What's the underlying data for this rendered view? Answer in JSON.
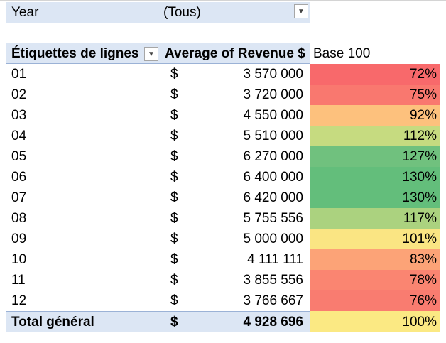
{
  "filter": {
    "label": "Year",
    "value": "(Tous)"
  },
  "header": {
    "row_labels": "Étiquettes de lignes",
    "revenue": "Average of Revenue $",
    "base": "Base 100"
  },
  "rows": [
    {
      "label": "01",
      "currency": "$",
      "value": "3 570 000",
      "base": "72%",
      "color": "#f8696b"
    },
    {
      "label": "02",
      "currency": "$",
      "value": "3 720 000",
      "base": "75%",
      "color": "#f9786f"
    },
    {
      "label": "03",
      "currency": "$",
      "value": "4 550 000",
      "base": "92%",
      "color": "#fdc17d"
    },
    {
      "label": "04",
      "currency": "$",
      "value": "5 510 000",
      "base": "112%",
      "color": "#c6db80"
    },
    {
      "label": "05",
      "currency": "$",
      "value": "6 270 000",
      "base": "127%",
      "color": "#70c17e"
    },
    {
      "label": "06",
      "currency": "$",
      "value": "6 400 000",
      "base": "130%",
      "color": "#63be7b"
    },
    {
      "label": "07",
      "currency": "$",
      "value": "6 420 000",
      "base": "130%",
      "color": "#63be7b"
    },
    {
      "label": "08",
      "currency": "$",
      "value": "5 755 556",
      "base": "117%",
      "color": "#abd27f"
    },
    {
      "label": "09",
      "currency": "$",
      "value": "5 000 000",
      "base": "101%",
      "color": "#fae583"
    },
    {
      "label": "10",
      "currency": "$",
      "value": "4 111 111",
      "base": "83%",
      "color": "#fca377"
    },
    {
      "label": "11",
      "currency": "$",
      "value": "3 855 556",
      "base": "78%",
      "color": "#fa8571"
    },
    {
      "label": "12",
      "currency": "$",
      "value": "3 766 667",
      "base": "76%",
      "color": "#f97c70"
    }
  ],
  "total": {
    "label": "Total général",
    "currency": "$",
    "value": "4 928 696",
    "base": "100%",
    "color": "#fbe983"
  }
}
